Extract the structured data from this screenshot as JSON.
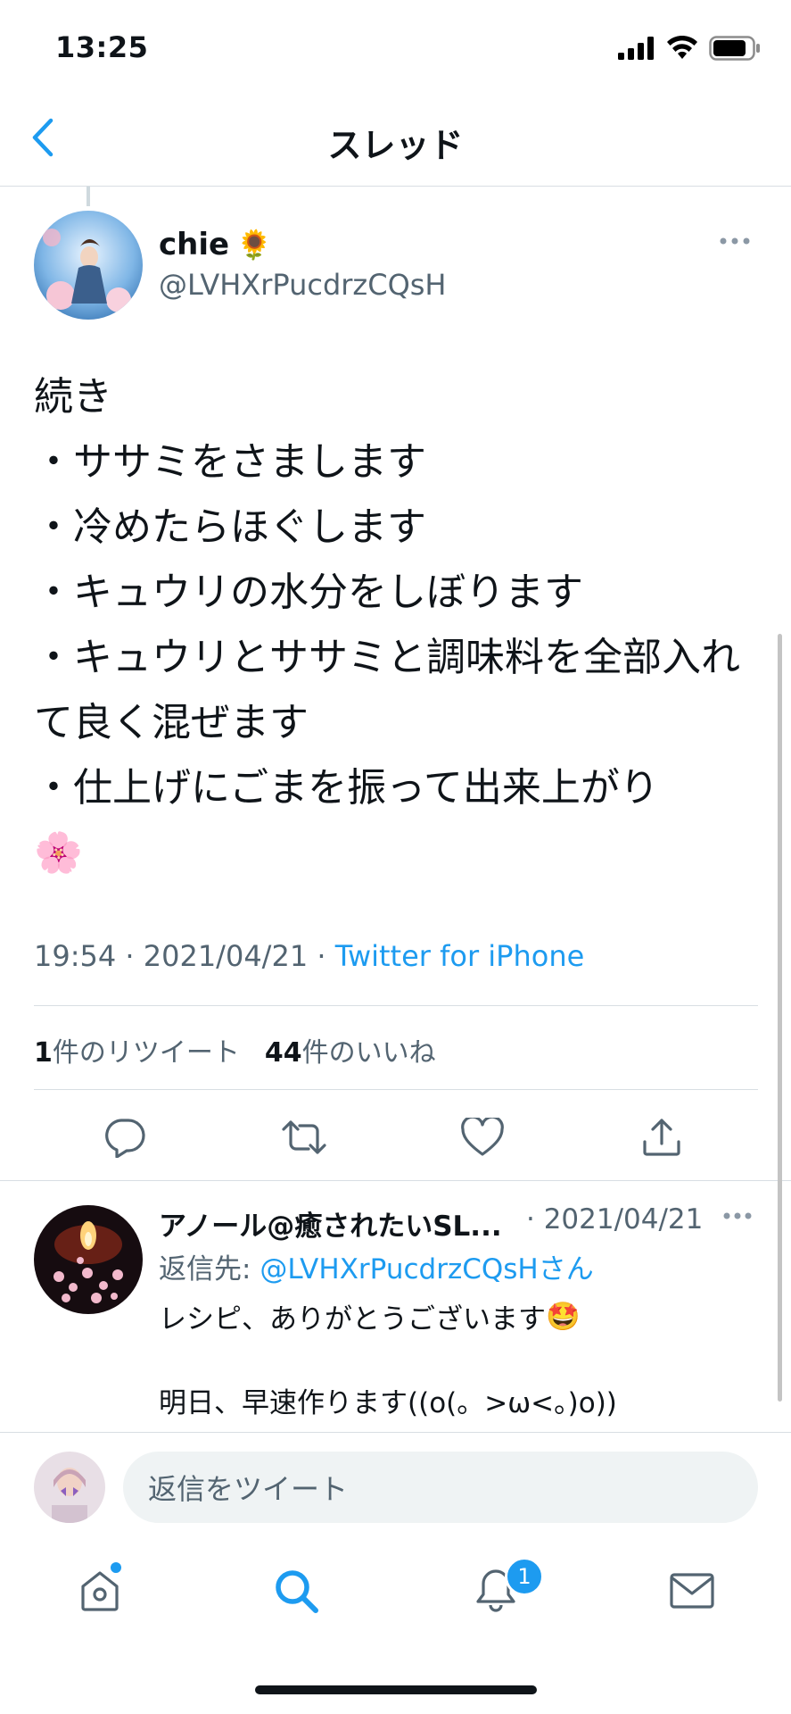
{
  "status_bar": {
    "time": "13:25"
  },
  "nav": {
    "title": "スレッド"
  },
  "main_tweet": {
    "name": "chie",
    "name_emoji": "🌻",
    "handle": "@LVHXrPucdrzCQsH",
    "text": "続き\n・ササミをさまします\n・冷めたらほぐします\n・キュウリの水分をしぼります\n・キュウリとササミと調味料を全部入れて良く混ぜます\n・仕上げにごまを振って出来上がり",
    "text_emoji": "🌸",
    "time": "19:54",
    "date": "2021/04/21",
    "source": "Twitter for iPhone",
    "retweet_count": "1",
    "retweet_label": "件のリツイート",
    "like_count": "44",
    "like_label": "件のいいね"
  },
  "reply": {
    "name": "アノール@癒されたいSL...",
    "date": "· 2021/04/21",
    "reply_to_label": "返信先: ",
    "reply_to_handle": "@LVHXrPucdrzCQsHさん",
    "line1": "レシピ、ありがとうございます",
    "line1_emoji": "🤩",
    "line2": "明日、早速作ります((o(。>ω<。)o))"
  },
  "composer": {
    "placeholder": "返信をツイート"
  },
  "tab_bar": {
    "items": [
      "home-icon",
      "search-icon",
      "notifications-icon",
      "messages-icon"
    ],
    "notification_badge": "1"
  },
  "colors": {
    "accent": "#1d9bf0",
    "text": "#0f1419",
    "secondary": "#536471"
  }
}
